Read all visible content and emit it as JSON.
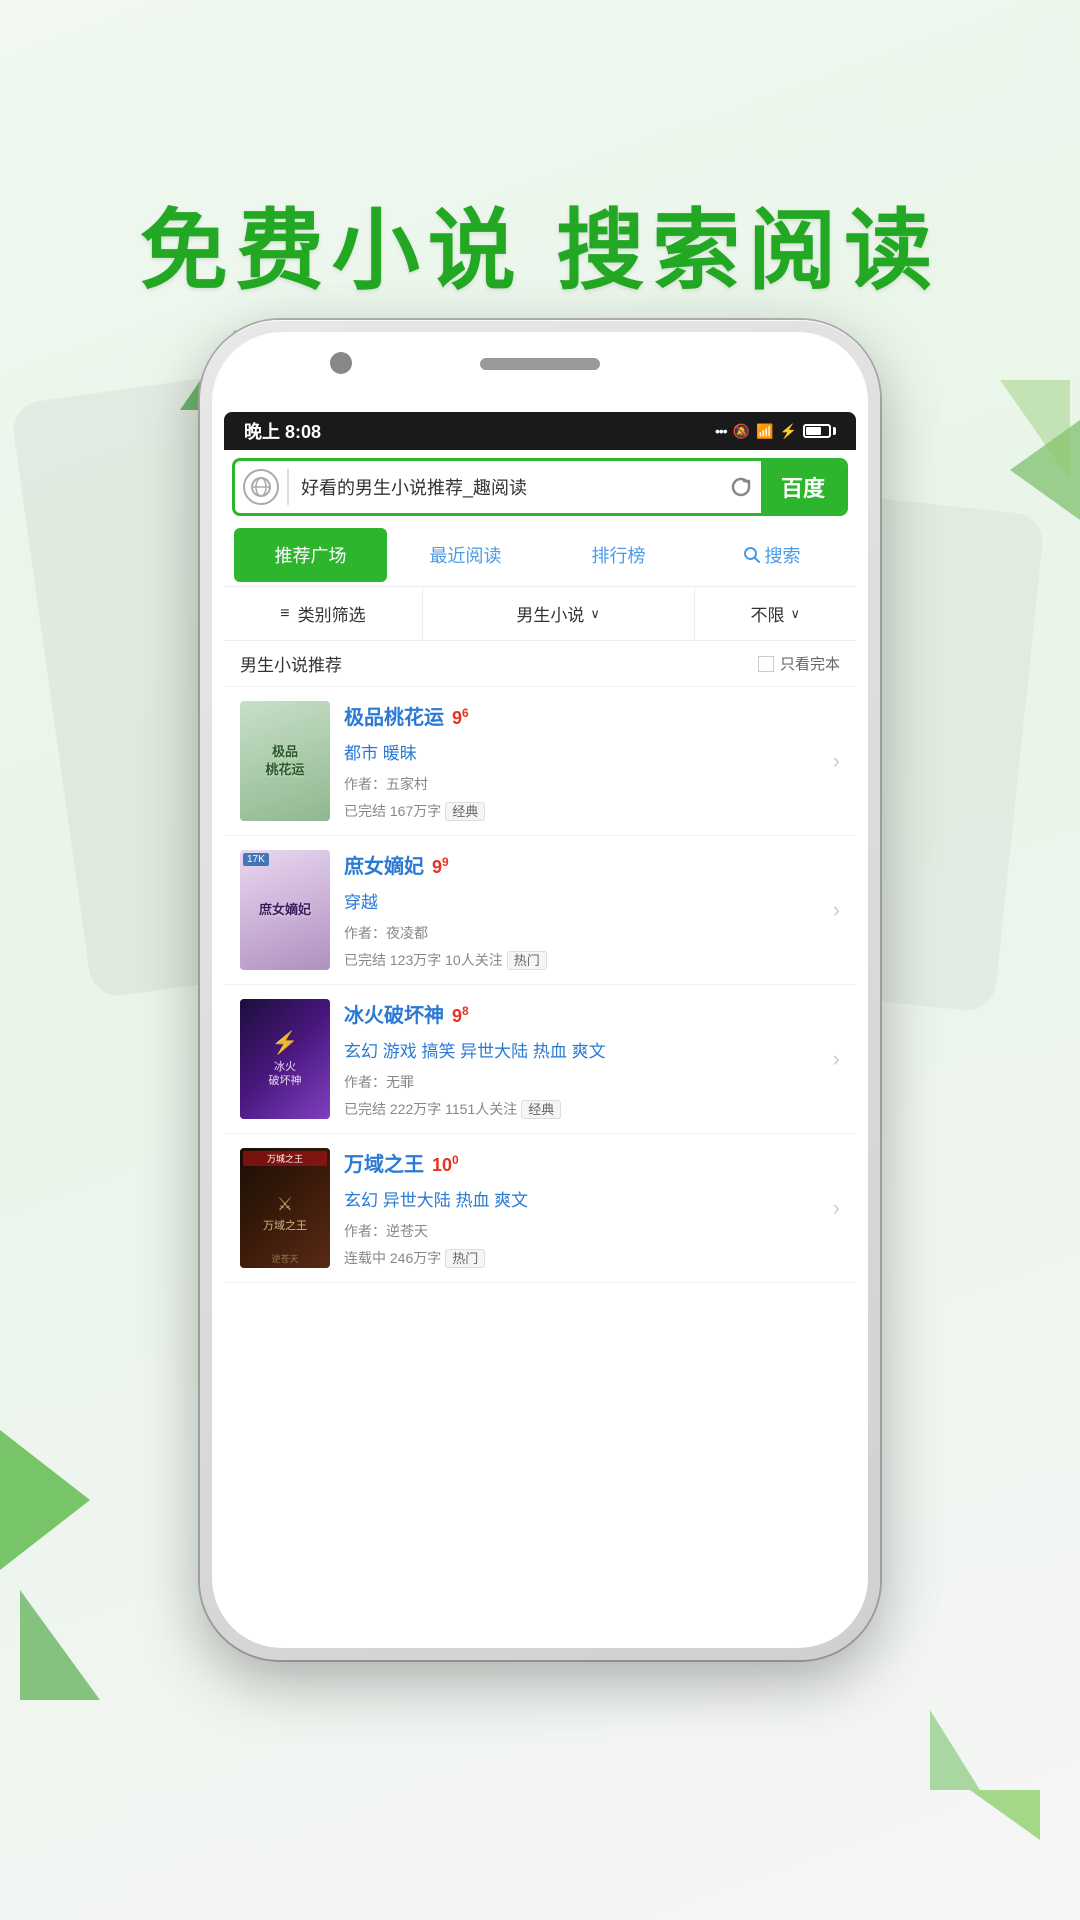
{
  "header": {
    "title": "免费小说  搜索阅读"
  },
  "status_bar": {
    "time": "晚上 8:08",
    "signal": "...",
    "silent": "🔔",
    "wifi": "WiFi",
    "battery": "70%"
  },
  "search": {
    "placeholder": "好看的男生小说推荐_趣阅读",
    "button_label": "百度"
  },
  "nav": {
    "tabs": [
      {
        "label": "推荐广场",
        "active": true
      },
      {
        "label": "最近阅读",
        "active": false
      },
      {
        "label": "排行榜",
        "active": false
      },
      {
        "label": "搜索",
        "active": false,
        "has_icon": true
      }
    ]
  },
  "filter": {
    "category_label": "类别筛选",
    "type_label": "男生小说",
    "limit_label": "不限"
  },
  "section": {
    "title": "男生小说推荐",
    "filter_label": "只看完本"
  },
  "books": [
    {
      "title": "极品桃花运",
      "rating": "9",
      "rating_decimal": "6",
      "genre": "都市 暖昧",
      "author": "作者：五家村",
      "stats": "已完结 167万字",
      "tag": "经典",
      "cover_class": "cover-1",
      "cover_title": "极品\n桃花运"
    },
    {
      "title": "庶女嫡妃",
      "rating": "9",
      "rating_decimal": "9",
      "genre": "穿越",
      "author": "作者：夜凌都",
      "stats": "已完结 123万字 10人关注",
      "tag": "热门",
      "cover_class": "cover-2",
      "cover_badge": "17K",
      "cover_title": "庶女嫡妃"
    },
    {
      "title": "冰火破坏神",
      "rating": "9",
      "rating_decimal": "8",
      "genre": "玄幻 游戏 搞笑 异世大陆 热血 爽文",
      "author": "作者：无罪",
      "stats": "已完结 222万字 1151人关注",
      "tag": "经典",
      "cover_class": "cover-3",
      "cover_title": "冰火破坏神"
    },
    {
      "title": "万域之王",
      "rating": "10",
      "rating_decimal": "0",
      "genre": "玄幻 异世大陆 热血 爽文",
      "author": "作者：逆苍天",
      "stats": "连载中 246万字",
      "tag": "热门",
      "cover_class": "cover-4",
      "cover_badge": "万城之王",
      "cover_title": "万域之王"
    }
  ]
}
